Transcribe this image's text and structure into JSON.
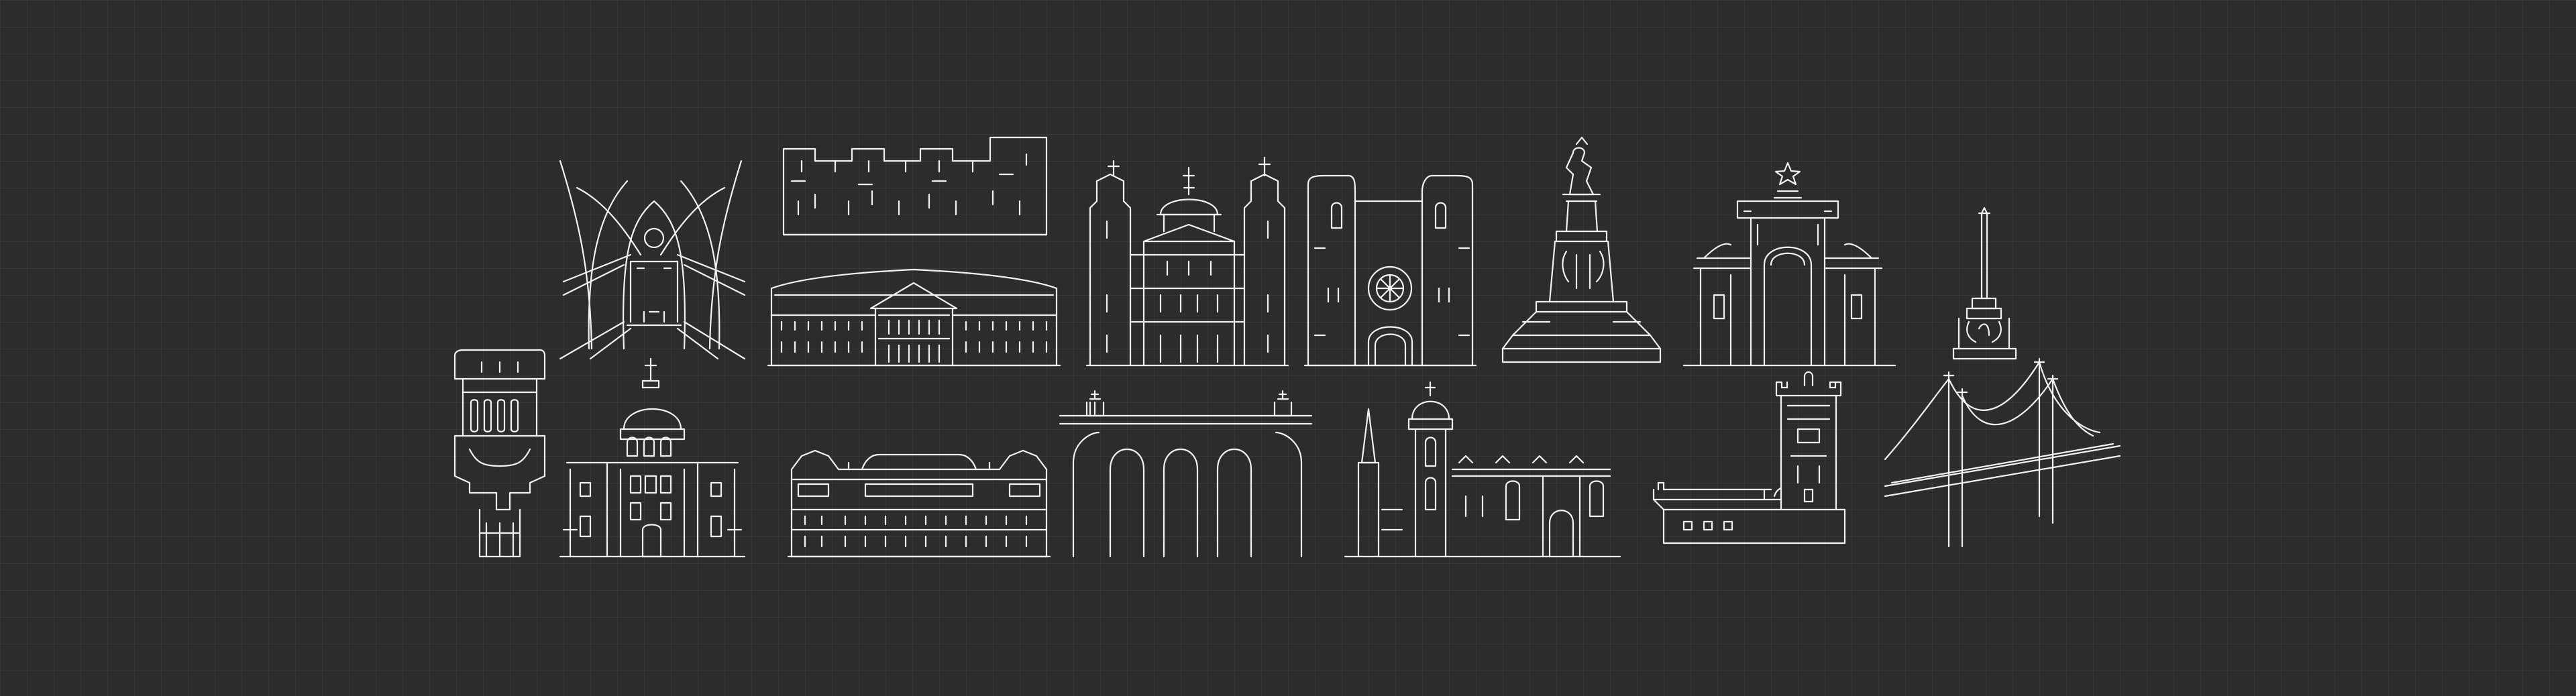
{
  "scene": {
    "background": "#2c2c2c",
    "grid_color": "rgba(255,255,255,0.05)",
    "line_color": "#f2f2f2",
    "style": "line-art illustrations of Lisbon landmarks on a dark grid"
  },
  "landmarks": [
    {
      "id": "carmo-convent-arches",
      "icon": "gothic-arches-icon"
    },
    {
      "id": "sao-jorge-castle-walls",
      "icon": "castle-battlements-icon"
    },
    {
      "id": "parliament-palace",
      "icon": "neoclassical-palace-icon"
    },
    {
      "id": "estrela-basilica",
      "icon": "domed-basilica-icon"
    },
    {
      "id": "lisbon-cathedral",
      "icon": "cathedral-rose-window-icon"
    },
    {
      "id": "marques-pombal-monument",
      "icon": "statue-column-icon"
    },
    {
      "id": "rua-augusta-arch",
      "icon": "triumphal-arch-icon"
    },
    {
      "id": "restauradores-obelisk",
      "icon": "obelisk-icon"
    },
    {
      "id": "santa-justa-lift",
      "icon": "elevator-tower-icon"
    },
    {
      "id": "national-pantheon",
      "icon": "domed-church-icon"
    },
    {
      "id": "ajuda-palace",
      "icon": "palace-facade-icon"
    },
    {
      "id": "aguas-livres-aqueduct",
      "icon": "aqueduct-arches-icon"
    },
    {
      "id": "jeronimos-monastery",
      "icon": "monastery-icon"
    },
    {
      "id": "belem-tower",
      "icon": "fortress-tower-icon"
    },
    {
      "id": "25-de-abril-bridge",
      "icon": "suspension-bridge-icon"
    }
  ]
}
